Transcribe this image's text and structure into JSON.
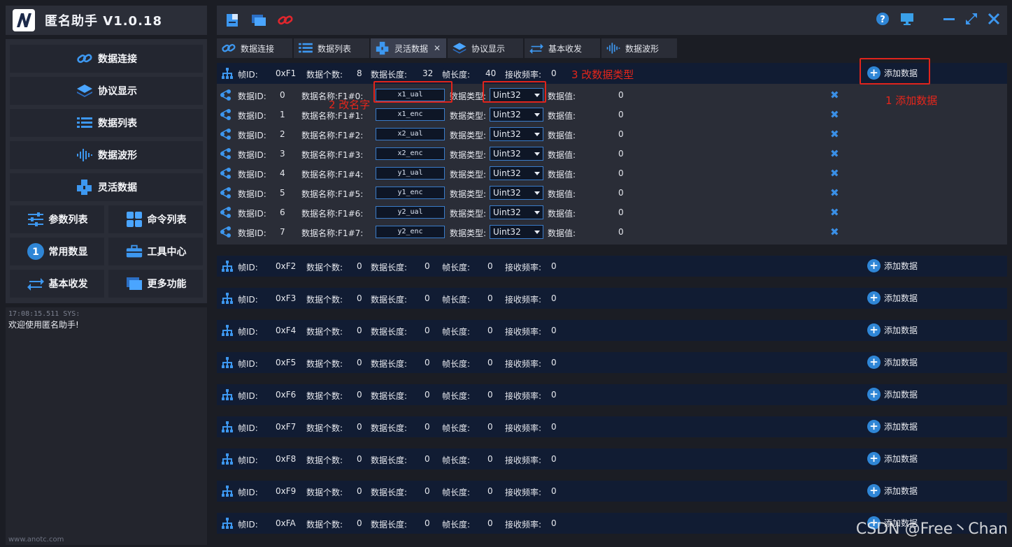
{
  "app": {
    "title": "匿名助手  V1.0.18"
  },
  "nav": {
    "items": [
      {
        "label": "数据连接",
        "icon": "link-icon"
      },
      {
        "label": "协议显示",
        "icon": "layers-icon"
      },
      {
        "label": "数据列表",
        "icon": "list-icon"
      },
      {
        "label": "数据波形",
        "icon": "waveform-icon"
      },
      {
        "label": "灵活数据",
        "icon": "cubes-icon"
      }
    ],
    "grid": [
      {
        "label": "参数列表",
        "icon": "sliders-icon"
      },
      {
        "label": "命令列表",
        "icon": "grid-icon"
      },
      {
        "label": "常用数显",
        "icon": "number-one-icon"
      },
      {
        "label": "工具中心",
        "icon": "toolbox-icon"
      },
      {
        "label": "基本收发",
        "icon": "transfer-icon"
      },
      {
        "label": "更多功能",
        "icon": "windows-icon"
      }
    ]
  },
  "log": {
    "timestamp": "17:08:15.511 SYS:",
    "message": "欢迎使用匿名助手!",
    "footer": "www.anotc.com"
  },
  "tabs": [
    {
      "label": "数据连接",
      "icon": "link-icon",
      "active": false
    },
    {
      "label": "数据列表",
      "icon": "list-icon",
      "active": false
    },
    {
      "label": "灵活数据",
      "icon": "cubes-icon",
      "active": true,
      "close": "✕"
    },
    {
      "label": "协议显示",
      "icon": "layers-icon",
      "active": false
    },
    {
      "label": "基本收发",
      "icon": "transfer-icon",
      "active": false
    },
    {
      "label": "数据波形",
      "icon": "waveform-icon",
      "active": false
    }
  ],
  "labels": {
    "frame_id": "帧ID:",
    "data_count": "数据个数:",
    "data_length": "数据长度:",
    "frame_length": "帧长度:",
    "recv_freq": "接收频率:",
    "add_data": "添加数据",
    "data_id": "数据ID:",
    "data_type": "数据类型:",
    "data_value": "数据值:"
  },
  "frames": [
    {
      "id": "0xF1",
      "count": "8",
      "data_len": "32",
      "frame_len": "40",
      "freq": "0",
      "expanded": true
    },
    {
      "id": "0xF2",
      "count": "0",
      "data_len": "0",
      "frame_len": "0",
      "freq": "0"
    },
    {
      "id": "0xF3",
      "count": "0",
      "data_len": "0",
      "frame_len": "0",
      "freq": "0"
    },
    {
      "id": "0xF4",
      "count": "0",
      "data_len": "0",
      "frame_len": "0",
      "freq": "0"
    },
    {
      "id": "0xF5",
      "count": "0",
      "data_len": "0",
      "frame_len": "0",
      "freq": "0"
    },
    {
      "id": "0xF6",
      "count": "0",
      "data_len": "0",
      "frame_len": "0",
      "freq": "0"
    },
    {
      "id": "0xF7",
      "count": "0",
      "data_len": "0",
      "frame_len": "0",
      "freq": "0"
    },
    {
      "id": "0xF8",
      "count": "0",
      "data_len": "0",
      "frame_len": "0",
      "freq": "0"
    },
    {
      "id": "0xF9",
      "count": "0",
      "data_len": "0",
      "frame_len": "0",
      "freq": "0"
    },
    {
      "id": "0xFA",
      "count": "0",
      "data_len": "0",
      "frame_len": "0",
      "freq": "0"
    }
  ],
  "data_items": [
    {
      "id": "0",
      "name_label": "数据名称:F1#0:",
      "name": "x1_ual",
      "type": "Uint32",
      "value": "0"
    },
    {
      "id": "1",
      "name_label": "数据名称:F1#1:",
      "name": "x1_enc",
      "type": "Uint32",
      "value": "0"
    },
    {
      "id": "2",
      "name_label": "数据名称:F1#2:",
      "name": "x2_ual",
      "type": "Uint32",
      "value": "0"
    },
    {
      "id": "3",
      "name_label": "数据名称:F1#3:",
      "name": "x2_enc",
      "type": "Uint32",
      "value": "0"
    },
    {
      "id": "4",
      "name_label": "数据名称:F1#4:",
      "name": "y1_ual",
      "type": "Uint32",
      "value": "0"
    },
    {
      "id": "5",
      "name_label": "数据名称:F1#5:",
      "name": "y1_enc",
      "type": "Uint32",
      "value": "0"
    },
    {
      "id": "6",
      "name_label": "数据名称:F1#6:",
      "name": "y2_ual",
      "type": "Uint32",
      "value": "0"
    },
    {
      "id": "7",
      "name_label": "数据名称:F1#7:",
      "name": "y2_enc",
      "type": "Uint32",
      "value": "0"
    }
  ],
  "annotations": {
    "step1": "1 添加数据",
    "step2": "2 改名字",
    "step3": "3 改数据类型"
  },
  "watermark": "CSDN @Free丶Chan",
  "colors": {
    "accent": "#2f86d6",
    "annotation": "#e0241c",
    "frame_bg": "#111c33"
  }
}
